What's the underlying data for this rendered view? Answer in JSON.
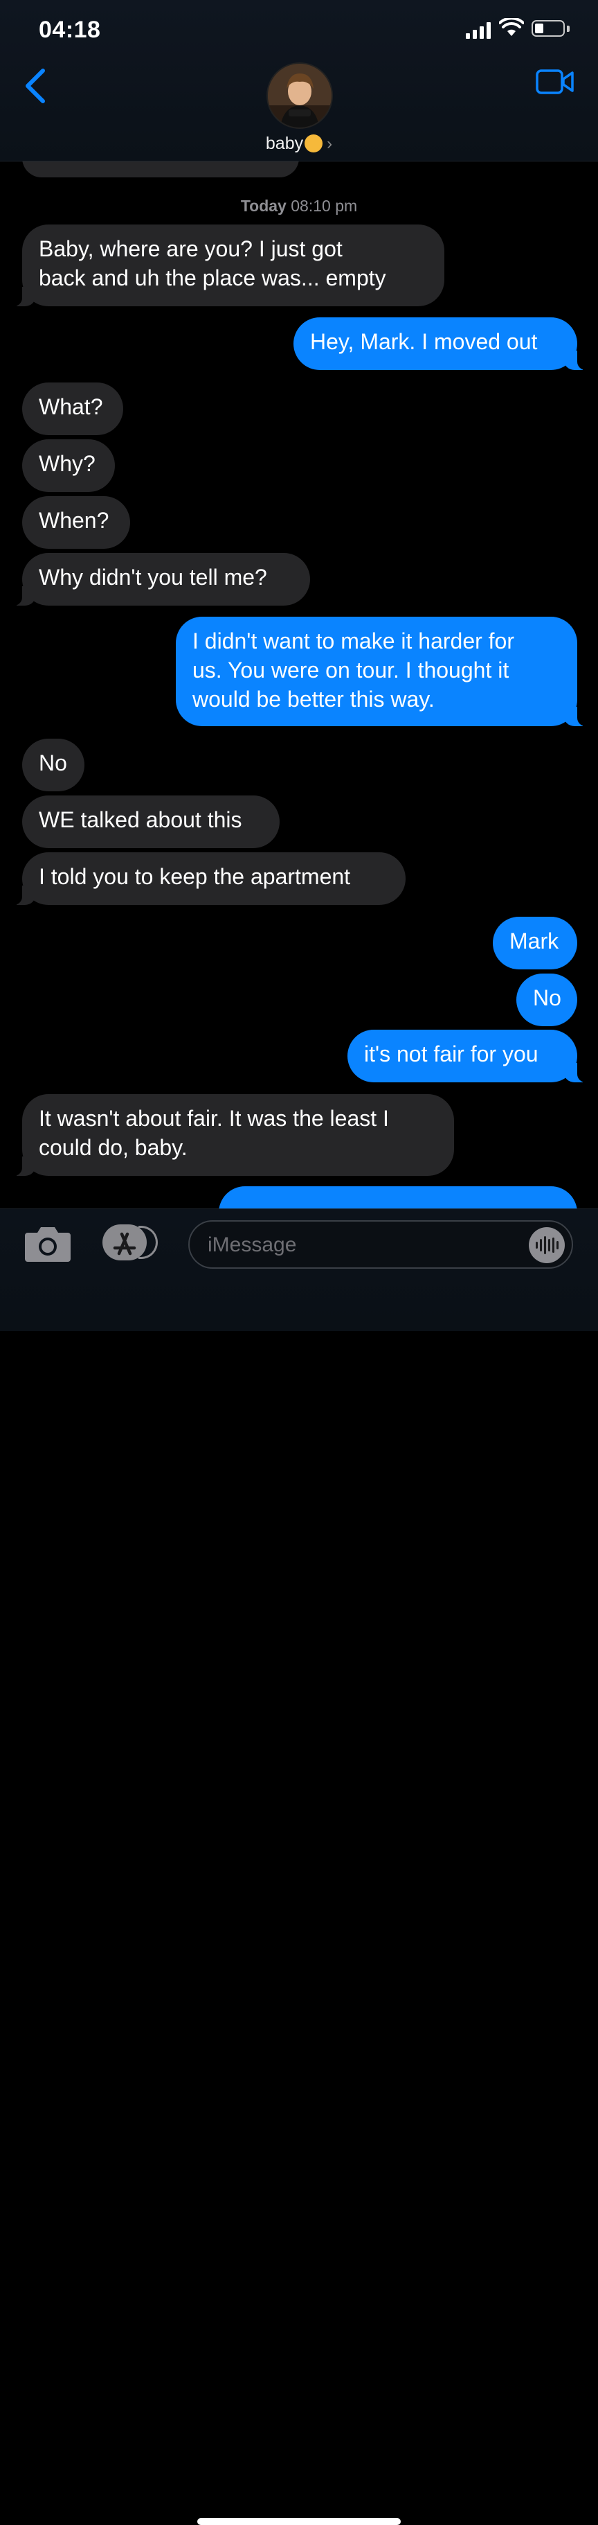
{
  "status_bar": {
    "time": "04:18"
  },
  "header": {
    "contact_name": "baby"
  },
  "timestamp": {
    "day": "Today",
    "time": "08:10 pm"
  },
  "messages": [
    {
      "lines": [
        "Baby, where are you? I just got",
        "back and uh the place was... empty"
      ],
      "dir": "in"
    },
    {
      "lines": [
        "Hey, Mark. I moved out"
      ],
      "dir": "out"
    },
    {
      "lines": [
        "What?"
      ],
      "dir": "in"
    },
    {
      "lines": [
        "Why?"
      ],
      "dir": "in"
    },
    {
      "lines": [
        "When?"
      ],
      "dir": "in"
    },
    {
      "lines": [
        "Why didn't you tell me?"
      ],
      "dir": "in"
    },
    {
      "lines": [
        "I didn't want to make it harder for",
        "us. You were on tour. I thought it",
        "would be better this way."
      ],
      "dir": "out"
    },
    {
      "lines": [
        "No"
      ],
      "dir": "in"
    },
    {
      "lines": [
        "WE talked about this"
      ],
      "dir": "in"
    },
    {
      "lines": [
        "I told you to keep the apartment"
      ],
      "dir": "in"
    },
    {
      "lines": [
        "Mark"
      ],
      "dir": "out"
    },
    {
      "lines": [
        "No"
      ],
      "dir": "out"
    },
    {
      "lines": [
        "it's not fair for you"
      ],
      "dir": "out"
    },
    {
      "lines": [
        "It wasn't about fair. It was the least I",
        "could do, baby."
      ],
      "dir": "in"
    }
  ],
  "composer": {
    "placeholder": "iMessage"
  }
}
